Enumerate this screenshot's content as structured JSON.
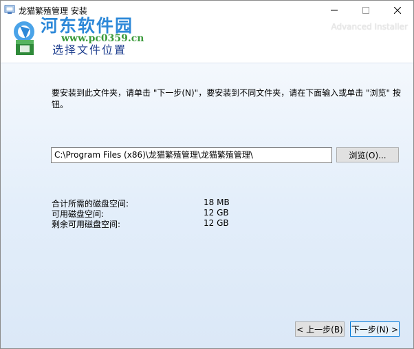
{
  "window": {
    "title": "龙猫繁殖管理 安装",
    "controls": {
      "minimize_icon": "minimize-icon",
      "maximize_icon": "maximize-icon",
      "close_icon": "close-icon"
    }
  },
  "header": {
    "watermark_title": "河东软件园",
    "watermark_url": "www.pc0359.cn",
    "page_title": "选择文件位置",
    "brand": "Advanced Installer"
  },
  "content": {
    "instruction": "要安装到此文件夹，请单击 \"下一步(N)\"，要安装到不同文件夹，请在下面输入或单击 \"浏览\" 按钮。",
    "install_path": "C:\\Program Files (x86)\\龙猫繁殖管理\\龙猫繁殖管理\\",
    "browse_label": "浏览(O)...",
    "disk": [
      {
        "label": "合计所需的磁盘空间:",
        "value": "18 MB"
      },
      {
        "label": "可用磁盘空间:",
        "value": "12 GB"
      },
      {
        "label": "剩余可用磁盘空间:",
        "value": "12 GB"
      }
    ]
  },
  "footer": {
    "back_label": "< 上一步(B)",
    "next_label": "下一步(N) >"
  },
  "colors": {
    "header_title": "#1f3f8f",
    "watermark_blue": "#2d88d8",
    "watermark_green": "#3a9a3a",
    "focus_border": "#0078d7"
  }
}
